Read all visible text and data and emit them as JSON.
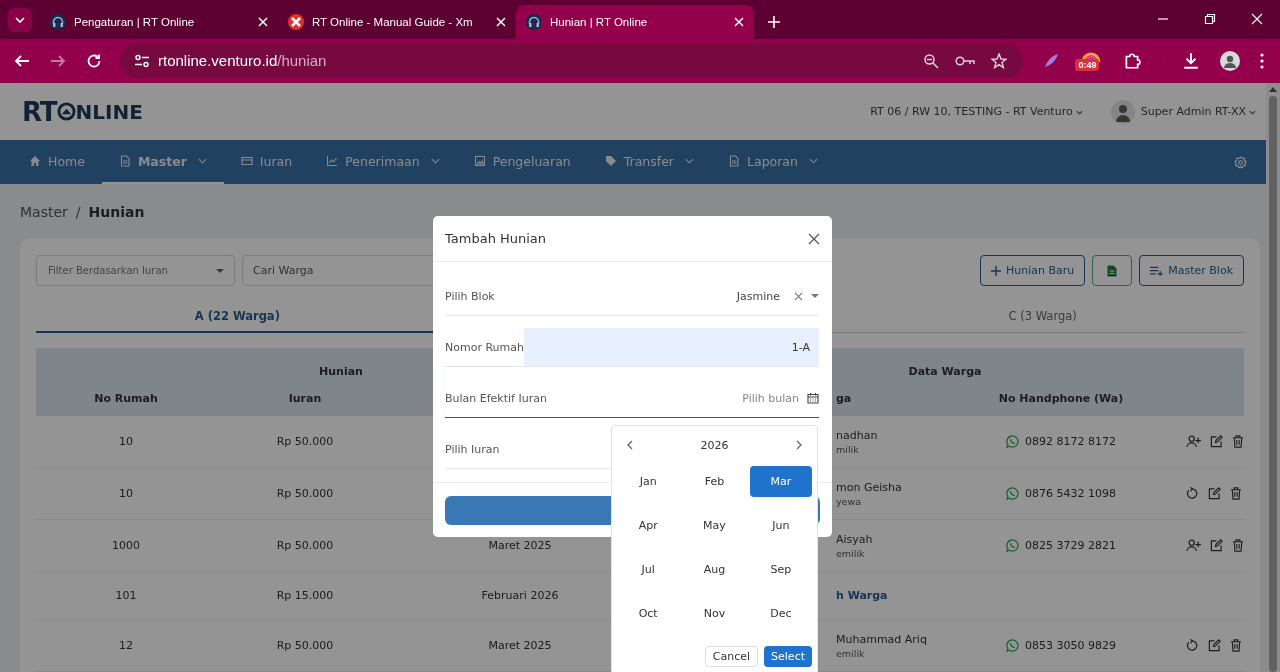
{
  "browser": {
    "tabs": [
      {
        "title": "Pengaturan | RT Online",
        "selected": false
      },
      {
        "title": "RT Online - Manual Guide - Xm",
        "selected": false
      },
      {
        "title": "Hunian | RT Online",
        "selected": true
      }
    ],
    "url": "rtonline.venturo.id/hunian",
    "extension_badge": "0:49"
  },
  "header": {
    "logo": {
      "left": "RT",
      "right": "NLINE"
    },
    "rt_selector": "RT 06 / RW 10, TESTING - RT Venturo",
    "user": "Super Admin RT-XX"
  },
  "nav": [
    {
      "label": "Home",
      "dropdown": false,
      "selected": false
    },
    {
      "label": "Master",
      "dropdown": true,
      "selected": true
    },
    {
      "label": "Iuran",
      "dropdown": false,
      "selected": false
    },
    {
      "label": "Penerimaan",
      "dropdown": true,
      "selected": false
    },
    {
      "label": "Pengeluaran",
      "dropdown": false,
      "selected": false
    },
    {
      "label": "Transfer",
      "dropdown": true,
      "selected": false
    },
    {
      "label": "Laporan",
      "dropdown": true,
      "selected": false
    }
  ],
  "breadcrumb": {
    "items": [
      "Master",
      "Hunian"
    ],
    "separator": "/"
  },
  "toolbar": {
    "filter": {
      "placeholder": "Filter Berdasarkan Iuran"
    },
    "search": {
      "placeholder": "Cari Warga"
    },
    "buttons": [
      {
        "kind": "outline",
        "label": "Hunian Baru"
      },
      {
        "kind": "export"
      },
      {
        "kind": "outline",
        "label": "Master Blok"
      }
    ]
  },
  "block_tabs": [
    {
      "label": "A (22 Warga)",
      "selected": true
    },
    {
      "label": "C (3 Warga)",
      "selected": false
    }
  ],
  "table": {
    "group_headers": [
      "Hunian",
      "Data Warga"
    ],
    "columns": {
      "no_rumah": "No Rumah",
      "iuran": "Iuran",
      "column_4": "ga",
      "no_handphone": "No Handphone (Wa)"
    },
    "rows": [
      {
        "kind": "resident",
        "no_rumah": "10",
        "iuran": "Rp 50.000",
        "name": "nadhan",
        "status": "milik",
        "phone": "0892 8172 8172",
        "actions": [
          {
            "kind": "add"
          },
          {
            "kind": "edit"
          },
          {
            "kind": "delete"
          }
        ]
      },
      {
        "kind": "resident",
        "no_rumah": "10",
        "iuran": "Rp 50.000",
        "name": "mon Geisha",
        "status": "yewa",
        "phone": "0876 5432 1098",
        "actions": [
          {
            "kind": "reset"
          },
          {
            "kind": "edit"
          },
          {
            "kind": "delete"
          }
        ]
      },
      {
        "kind": "resident",
        "no_rumah": "1000",
        "iuran": "Rp 50.000",
        "column_3": "Maret 2025",
        "name": "Aisyah",
        "status": "emilik",
        "phone": "0825 3729 2821",
        "actions": [
          {
            "kind": "add"
          },
          {
            "kind": "edit"
          },
          {
            "kind": "delete"
          }
        ]
      },
      {
        "kind": "empty",
        "no_rumah": "101",
        "iuran": "Rp 15.000",
        "column_3": "Februari 2026",
        "link": "h Warga"
      },
      {
        "kind": "resident",
        "no_rumah": "12",
        "iuran": "Rp 50.000",
        "column_3": "Maret 2025",
        "name": "Muhammad Ariq",
        "status": "emilik",
        "phone": "0853 3050 9829",
        "actions": [
          {
            "kind": "reset"
          },
          {
            "kind": "edit"
          },
          {
            "kind": "delete"
          }
        ]
      }
    ]
  },
  "modal": {
    "title": "Tambah Hunian",
    "fields": [
      {
        "kind": "select",
        "label": "Pilih Blok",
        "value": "Jasmine"
      },
      {
        "kind": "text",
        "label": "Nomor Rumah",
        "value": "1-A"
      },
      {
        "kind": "month",
        "label": "Bulan Efektif Iuran",
        "placeholder": "Pilih bulan",
        "focused": true
      },
      {
        "kind": "select",
        "label": "Pilih Iuran"
      }
    ]
  },
  "month_picker": {
    "year": "2026",
    "months": [
      {
        "label": "Jan",
        "selected": false
      },
      {
        "label": "Feb",
        "selected": false
      },
      {
        "label": "Mar",
        "selected": true
      },
      {
        "label": "Apr",
        "selected": false
      },
      {
        "label": "May",
        "selected": false
      },
      {
        "label": "Jun",
        "selected": false
      },
      {
        "label": "Jul",
        "selected": false
      },
      {
        "label": "Aug",
        "selected": false
      },
      {
        "label": "Sep",
        "selected": false
      },
      {
        "label": "Oct",
        "selected": false
      },
      {
        "label": "Nov",
        "selected": false
      },
      {
        "label": "Dec",
        "selected": false
      }
    ],
    "cancel": "Cancel",
    "select": "Select"
  }
}
